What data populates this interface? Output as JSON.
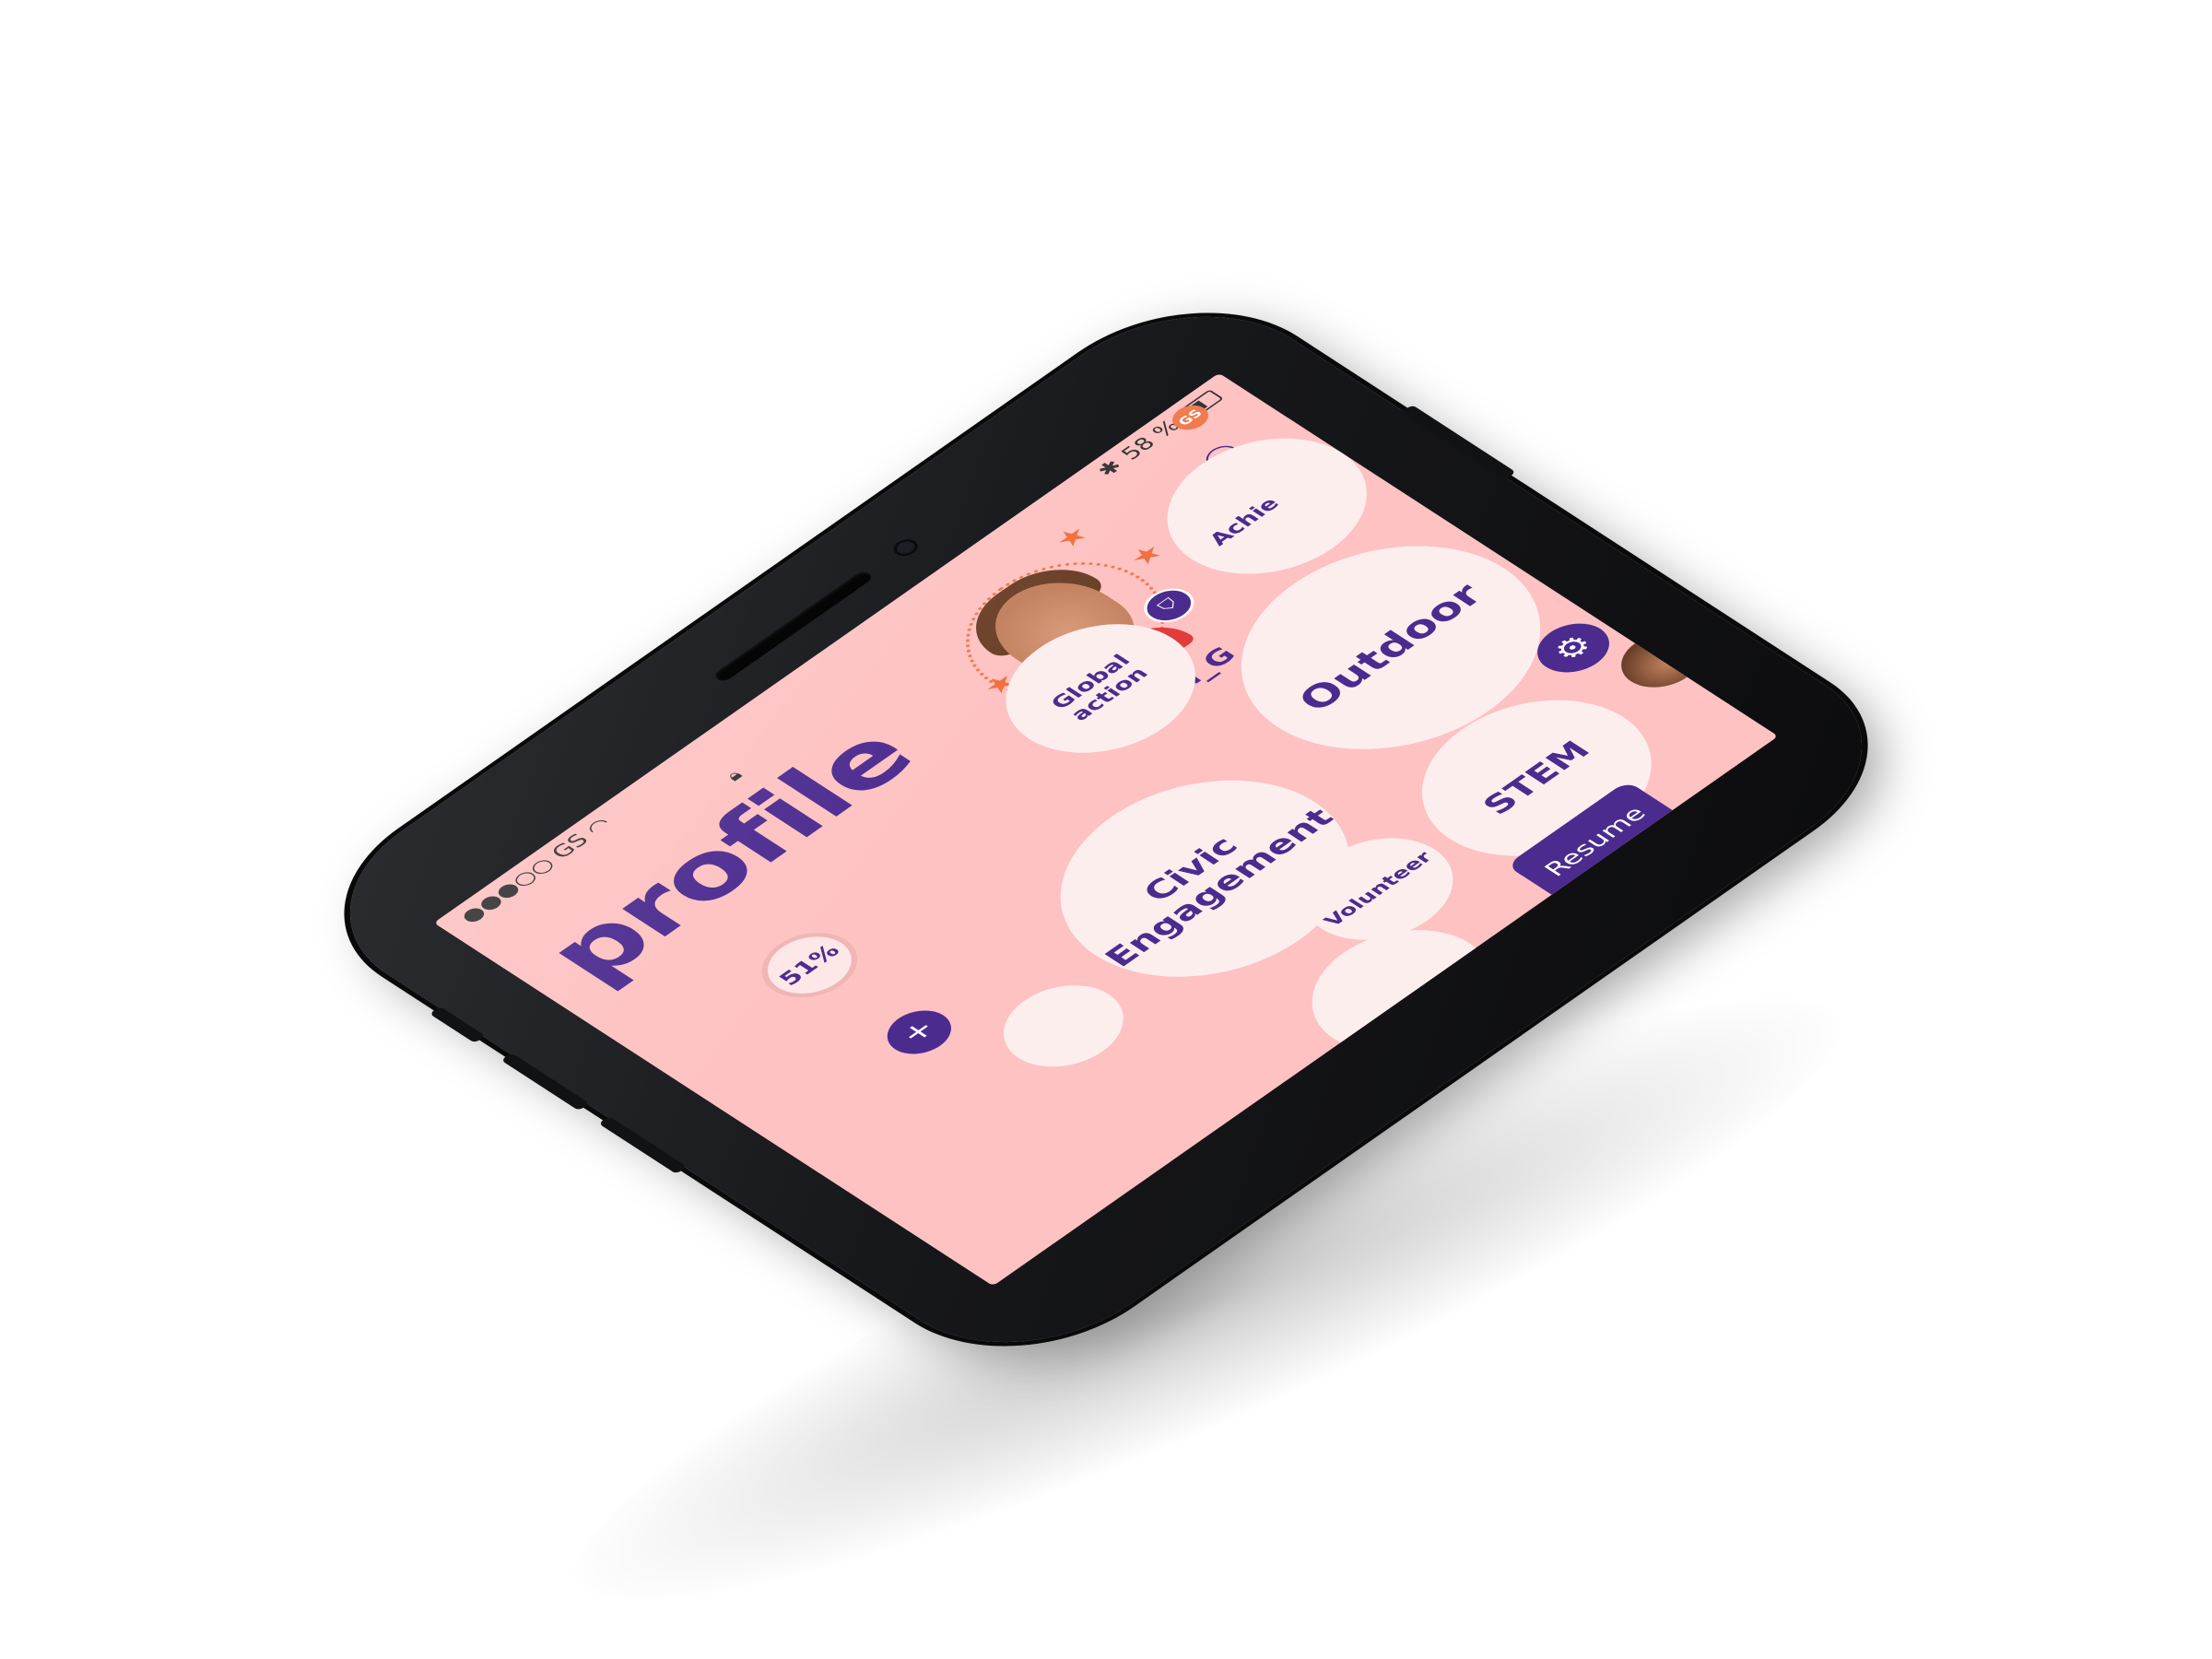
{
  "status_bar": {
    "carrier": "●●●○○ GS",
    "bluetooth": "✱",
    "battery_percent": "58 %",
    "profile_badge": "GS"
  },
  "header": {
    "title": "profile"
  },
  "profile": {
    "username": "@Ava_G",
    "completion": "51%"
  },
  "bubbles": [
    {
      "key": "global",
      "label": "Global\naction"
    },
    {
      "key": "achievements",
      "label": "Achie"
    },
    {
      "key": "outdoor",
      "label": "Outdoor"
    },
    {
      "key": "civic",
      "label": "Civic\nEngagement"
    },
    {
      "key": "volunteer",
      "label": "Volunteer"
    },
    {
      "key": "stem",
      "label": "STEM"
    }
  ],
  "actions": {
    "resume_label": "Resume",
    "plus_label": "+",
    "gear_label": "⚙",
    "add_user_label": "⚇"
  },
  "icons": {
    "lock": "lock-icon",
    "gear": "gear-icon",
    "add_user": "add-user-icon",
    "badge": "shield-icon"
  },
  "colors": {
    "screen_background": "#fec2c2",
    "accent_purple": "#4c2b8f",
    "bubble": "#fdeeee",
    "star_orange": "#f0703f"
  }
}
